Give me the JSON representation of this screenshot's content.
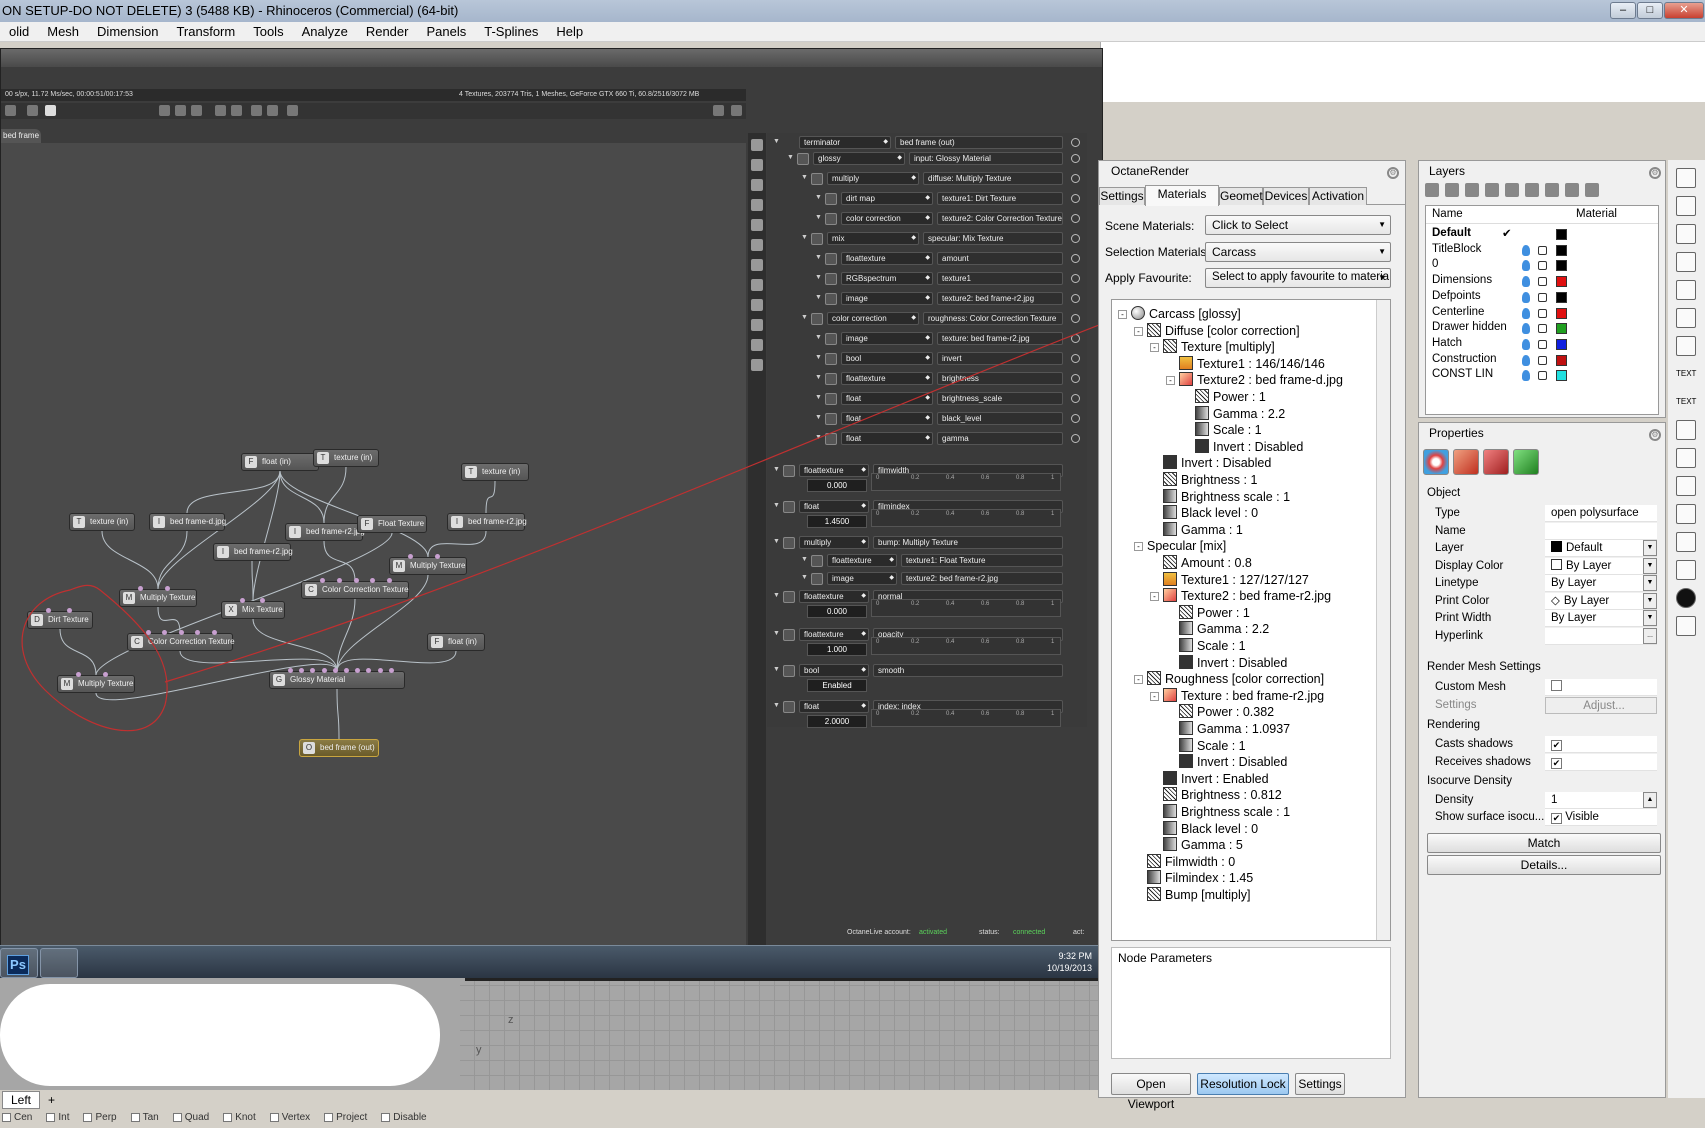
{
  "window": {
    "title": "ON SETUP-DO NOT DELETE) 3 (5488 KB) - Rhinoceros (Commercial) (64-bit)",
    "min_label": "–",
    "max_label": "□",
    "close_label": "✕"
  },
  "menu": [
    "olid",
    "Mesh",
    "Dimension",
    "Transform",
    "Tools",
    "Analyze",
    "Render",
    "Panels",
    "T-Splines",
    "Help"
  ],
  "octane_window": {
    "status_left": "00 s/px, 11.72 Ms/sec, 00:00:51/00:17:53",
    "status_right": "4 Textures, 203774 Tris, 1 Meshes, GeForce GTX 660 Ti, 60.8/2516/3072 MB",
    "tab_label": "bed frame",
    "account_label": "OctaneLive account:",
    "account_value": "activated",
    "status_label": "status:",
    "status_value": "connected",
    "act_label": "act:"
  },
  "nodes": [
    {
      "label": "float (in)",
      "icon": "F",
      "kind": "float"
    },
    {
      "label": "texture (in)",
      "icon": "T",
      "kind": "tex"
    },
    {
      "label": "texture (in)",
      "icon": "T",
      "kind": "tex"
    },
    {
      "label": "texture (in)",
      "icon": "T",
      "kind": "tex"
    },
    {
      "label": "bed frame-d.jpg",
      "icon": "I",
      "kind": "img"
    },
    {
      "label": "bed frame-r2.jpg",
      "icon": "I",
      "kind": "img"
    },
    {
      "label": "Float Texture",
      "icon": "F",
      "kind": "float"
    },
    {
      "label": "bed frame-r2.jpg",
      "icon": "I",
      "kind": "img"
    },
    {
      "label": "bed frame-r2.jpg",
      "icon": "I",
      "kind": "img"
    },
    {
      "label": "Multiply Texture",
      "icon": "M",
      "kind": "mult"
    },
    {
      "label": "Color Correction Texture",
      "icon": "C",
      "kind": "cc"
    },
    {
      "label": "Multiply Texture",
      "icon": "M",
      "kind": "mult"
    },
    {
      "label": "Mix Texture",
      "icon": "X",
      "kind": "mix"
    },
    {
      "label": "Dirt Texture",
      "icon": "D",
      "kind": "dirt"
    },
    {
      "label": "Color Correction Texture",
      "icon": "C",
      "kind": "cc"
    },
    {
      "label": "float (in)",
      "icon": "F",
      "kind": "float"
    },
    {
      "label": "Multiply Texture",
      "icon": "M",
      "kind": "mult"
    },
    {
      "label": "Glossy Material",
      "icon": "G",
      "kind": "mat"
    },
    {
      "label": "bed frame (out)",
      "icon": "O",
      "kind": "out"
    }
  ],
  "param_rows": [
    {
      "level": 0,
      "sel": "terminator",
      "label": "bed frame (out)"
    },
    {
      "level": 1,
      "sel": "glossy",
      "label": "input: Glossy Material"
    },
    {
      "level": 2,
      "sel": "multiply",
      "label": "diffuse: Multiply Texture"
    },
    {
      "level": 3,
      "sel": "dirt map",
      "label": "texture1: Dirt Texture"
    },
    {
      "level": 3,
      "sel": "color correction",
      "label": "texture2: Color Correction Texture"
    },
    {
      "level": 2,
      "sel": "mix",
      "label": "specular: Mix Texture"
    },
    {
      "level": 3,
      "sel": "floattexture",
      "label": "amount"
    },
    {
      "level": 3,
      "sel": "RGBspectrum",
      "label": "texture1"
    },
    {
      "level": 3,
      "sel": "image",
      "label": "texture2: bed frame-r2.jpg"
    },
    {
      "level": 2,
      "sel": "color correction",
      "label": "roughness: Color Correction Texture"
    },
    {
      "level": 3,
      "sel": "image",
      "label": "texture: bed frame-r2.jpg"
    },
    {
      "level": 3,
      "sel": "bool",
      "label": "invert"
    },
    {
      "level": 3,
      "sel": "floattexture",
      "label": "brightness"
    },
    {
      "level": 3,
      "sel": "float",
      "label": "brightness_scale"
    },
    {
      "level": 3,
      "sel": "float",
      "label": "black_level"
    },
    {
      "level": 3,
      "sel": "float",
      "label": "gamma"
    }
  ],
  "param_sliders": [
    {
      "sel": "floattexture",
      "label": "filmwidth",
      "value": "0.000"
    },
    {
      "sel": "float",
      "label": "filmindex",
      "value": "1.4500"
    },
    {
      "sel": "multiply",
      "label": "bump: Multiply Texture",
      "value": ""
    },
    {
      "sel": "floattexture",
      "label": "texture1: Float Texture",
      "value": ""
    },
    {
      "sel": "image",
      "label": "texture2: bed frame-r2.jpg",
      "value": ""
    },
    {
      "sel": "floattexture",
      "label": "normal",
      "value": "0.000"
    },
    {
      "sel": "floattexture",
      "label": "opacity",
      "value": "1.000"
    },
    {
      "sel": "bool",
      "label": "smooth",
      "value": "Enabled"
    },
    {
      "sel": "float",
      "label": "index: index",
      "value": "2.0000"
    }
  ],
  "slider_ticks": [
    "0",
    "0.2",
    "0.4",
    "0.6",
    "0.8",
    "1"
  ],
  "taskbar": {
    "ps_label": "Ps",
    "time": "9:32 PM",
    "date": "10/19/2013"
  },
  "viewport": {
    "tab": "Left",
    "add_tab": "+",
    "axis_z": "z",
    "axis_y": "y"
  },
  "snaps": [
    "Cen",
    "Int",
    "Perp",
    "Tan",
    "Quad",
    "Knot",
    "Vertex",
    "Project",
    "Disable"
  ],
  "octane_panel": {
    "title": "OctaneRender",
    "tabs": [
      "Settings",
      "Materials",
      "Geometry",
      "Devices",
      "Activation"
    ],
    "active_tab": 1,
    "scene_materials_label": "Scene Materials:",
    "scene_materials_value": "Click to Select",
    "selection_materials_label": "Selection Materials:",
    "selection_materials_value": "Carcass",
    "apply_favourite_label": "Apply Favourite:",
    "apply_favourite_value": "Select to apply favourite to materia",
    "node_parameters_label": "Node Parameters",
    "open_viewport": "Open Viewport",
    "resolution_lock": "Resolution Lock",
    "settings": "Settings"
  },
  "tree": [
    {
      "d": 0,
      "t": "Carcass  [glossy]",
      "i": "sph",
      "e": "-"
    },
    {
      "d": 1,
      "t": "Diffuse  [color correction]",
      "i": "cc",
      "e": "-"
    },
    {
      "d": 2,
      "t": "Texture  [multiply]",
      "i": "cc",
      "e": "-"
    },
    {
      "d": 3,
      "t": "Texture1 : 146/146/146",
      "i": "bg",
      "e": ""
    },
    {
      "d": 3,
      "t": "Texture2 : bed frame-d.jpg",
      "i": "img",
      "e": "-"
    },
    {
      "d": 4,
      "t": "Power : 1",
      "i": "cc",
      "e": ""
    },
    {
      "d": 4,
      "t": "Gamma : 2.2",
      "i": "gr",
      "e": ""
    },
    {
      "d": 4,
      "t": "Scale : 1",
      "i": "gr",
      "e": ""
    },
    {
      "d": 4,
      "t": "Invert : Disabled",
      "i": "dk",
      "e": ""
    },
    {
      "d": 2,
      "t": "Invert : Disabled",
      "i": "dk",
      "e": ""
    },
    {
      "d": 2,
      "t": "Brightness : 1",
      "i": "cc",
      "e": ""
    },
    {
      "d": 2,
      "t": "Brightness scale : 1",
      "i": "gr",
      "e": ""
    },
    {
      "d": 2,
      "t": "Black level : 0",
      "i": "gr",
      "e": ""
    },
    {
      "d": 2,
      "t": "Gamma : 1",
      "i": "gr",
      "e": ""
    },
    {
      "d": 1,
      "t": "Specular  [mix]",
      "i": "none",
      "e": "-"
    },
    {
      "d": 2,
      "t": "Amount : 0.8",
      "i": "cc",
      "e": ""
    },
    {
      "d": 2,
      "t": "Texture1 : 127/127/127",
      "i": "bg",
      "e": ""
    },
    {
      "d": 2,
      "t": "Texture2 : bed frame-r2.jpg",
      "i": "img",
      "e": "-"
    },
    {
      "d": 3,
      "t": "Power : 1",
      "i": "cc",
      "e": ""
    },
    {
      "d": 3,
      "t": "Gamma : 2.2",
      "i": "gr",
      "e": ""
    },
    {
      "d": 3,
      "t": "Scale : 1",
      "i": "gr",
      "e": ""
    },
    {
      "d": 3,
      "t": "Invert : Disabled",
      "i": "dk",
      "e": ""
    },
    {
      "d": 1,
      "t": "Roughness  [color correction]",
      "i": "cc",
      "e": "-"
    },
    {
      "d": 2,
      "t": "Texture : bed frame-r2.jpg",
      "i": "img",
      "e": "-"
    },
    {
      "d": 3,
      "t": "Power : 0.382",
      "i": "cc",
      "e": ""
    },
    {
      "d": 3,
      "t": "Gamma : 1.0937",
      "i": "gr",
      "e": ""
    },
    {
      "d": 3,
      "t": "Scale : 1",
      "i": "gr",
      "e": ""
    },
    {
      "d": 3,
      "t": "Invert : Disabled",
      "i": "dk",
      "e": ""
    },
    {
      "d": 2,
      "t": "Invert : Enabled",
      "i": "dk",
      "e": ""
    },
    {
      "d": 2,
      "t": "Brightness : 0.812",
      "i": "cc",
      "e": ""
    },
    {
      "d": 2,
      "t": "Brightness scale : 1",
      "i": "gr",
      "e": ""
    },
    {
      "d": 2,
      "t": "Black level : 0",
      "i": "gr",
      "e": ""
    },
    {
      "d": 2,
      "t": "Gamma : 5",
      "i": "gr",
      "e": ""
    },
    {
      "d": 1,
      "t": "Filmwidth : 0",
      "i": "cc",
      "e": ""
    },
    {
      "d": 1,
      "t": "Filmindex : 1.45",
      "i": "gr",
      "e": ""
    },
    {
      "d": 1,
      "t": "Bump  [multiply]",
      "i": "cc",
      "e": ""
    }
  ],
  "layers_panel": {
    "title": "Layers",
    "col_name": "Name",
    "col_material": "Material",
    "rows": [
      {
        "name": "Default",
        "current": true,
        "color": "#000000"
      },
      {
        "name": "TitleBlock",
        "current": false,
        "color": "#000000"
      },
      {
        "name": "0",
        "current": false,
        "color": "#000000"
      },
      {
        "name": "Dimensions",
        "current": false,
        "color": "#e01010"
      },
      {
        "name": "Defpoints",
        "current": false,
        "color": "#000000"
      },
      {
        "name": "Centerline",
        "current": false,
        "color": "#e01010"
      },
      {
        "name": "Drawer hidden",
        "current": false,
        "color": "#20a020"
      },
      {
        "name": "Hatch",
        "current": false,
        "color": "#1020e0"
      },
      {
        "name": "Construction",
        "current": false,
        "color": "#c01010"
      },
      {
        "name": "CONST LIN",
        "current": false,
        "color": "#20e0e0"
      }
    ],
    "check": "✔"
  },
  "properties_panel": {
    "title": "Properties",
    "object_section": "Object",
    "rows": [
      {
        "label": "Type",
        "value": "open polysurface",
        "dd": false
      },
      {
        "label": "Name",
        "value": "",
        "dd": false
      },
      {
        "label": "Layer",
        "value": "Default",
        "dd": true
      },
      {
        "label": "Display Color",
        "value": "By Layer",
        "dd": true
      },
      {
        "label": "Linetype",
        "value": "By Layer",
        "dd": true
      },
      {
        "label": "Print Color",
        "value": "By Layer",
        "dd": true
      },
      {
        "label": "Print Width",
        "value": "By Layer",
        "dd": true
      },
      {
        "label": "Hyperlink",
        "value": "",
        "dd": false
      }
    ],
    "render_mesh_section": "Render Mesh Settings",
    "custom_mesh_label": "Custom Mesh",
    "settings_label": "Settings",
    "adjust_button": "Adjust...",
    "rendering_section": "Rendering",
    "casts_shadows_label": "Casts shadows",
    "receives_shadows_label": "Receives shadows",
    "isocurve_section": "Isocurve Density",
    "density_label": "Density",
    "density_value": "1",
    "show_surface_label": "Show surface isocu...",
    "visible_label": "Visible",
    "match_button": "Match",
    "details_button": "Details..."
  },
  "right_tools_text": [
    "TEXT",
    "TEXT"
  ]
}
